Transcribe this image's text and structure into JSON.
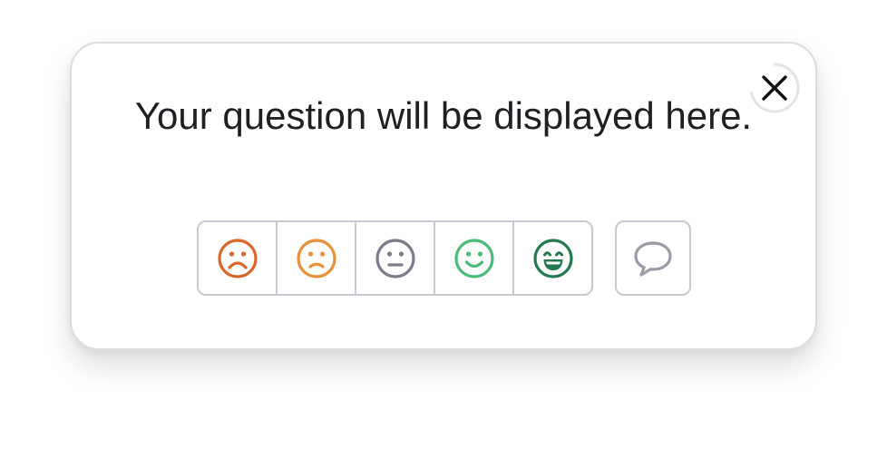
{
  "survey": {
    "question": "Your question will be displayed here.",
    "close_icon": "close-icon",
    "ratings": [
      {
        "icon": "very-sad-face-icon",
        "color": "#d9672a"
      },
      {
        "icon": "sad-face-icon",
        "color": "#e98f3a"
      },
      {
        "icon": "neutral-face-icon",
        "color": "#7a7c8c"
      },
      {
        "icon": "smile-face-icon",
        "color": "#4cbd79"
      },
      {
        "icon": "laughing-face-icon",
        "color": "#237a4f"
      }
    ],
    "comment_icon": "speech-bubble-icon",
    "comment_color": "#9a9ca8",
    "border_color": "#c8c9d2"
  }
}
